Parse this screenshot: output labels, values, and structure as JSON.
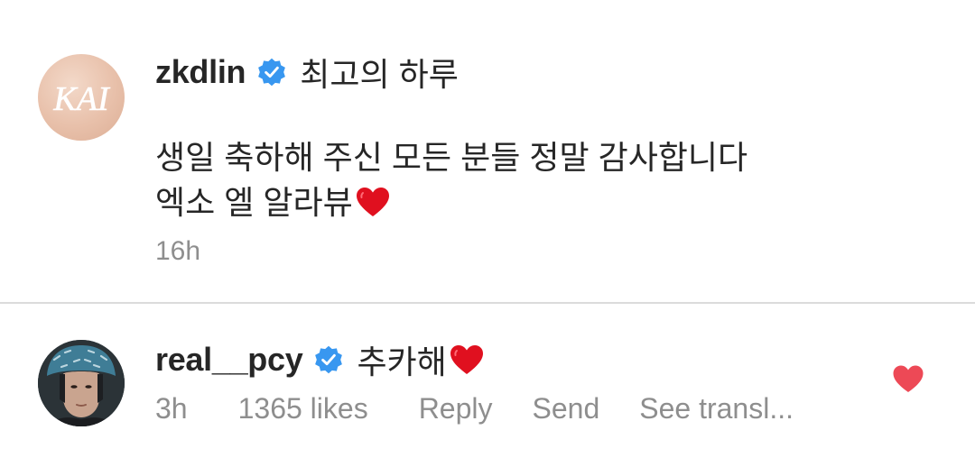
{
  "post": {
    "avatar_text": "KAI",
    "username": "zkdlin",
    "title": "최고의 하루",
    "body_lines": [
      "생일 축하해 주신 모든 분들 정말 감사합니다",
      "엑소 엘 알라뷰"
    ],
    "time": "16h"
  },
  "comment": {
    "username": "real__pcy",
    "text": "추카해",
    "time": "3h",
    "likes": "1365 likes",
    "reply_label": "Reply",
    "send_label": "Send",
    "translate_label": "See transl..."
  },
  "icons": {
    "verified": "verified-badge-icon",
    "heart_emoji": "red-heart-emoji",
    "like": "heart-filled-icon"
  },
  "colors": {
    "verified_blue": "#3897f0",
    "heart_red": "#ed4956",
    "emoji_red": "#e0101f",
    "secondary_text": "#8e8e8e",
    "primary_text": "#262626"
  }
}
